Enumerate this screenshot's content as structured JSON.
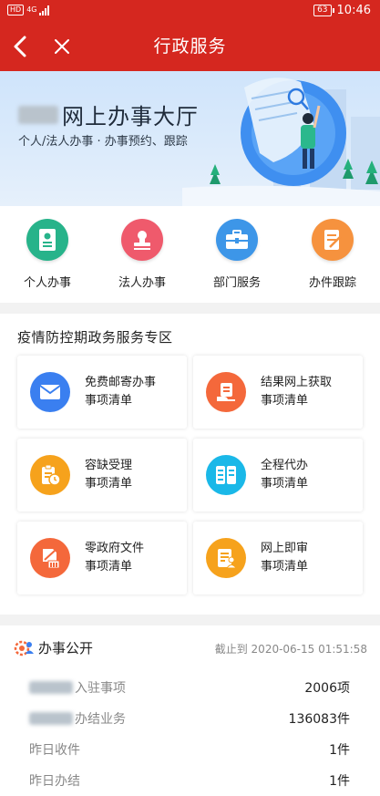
{
  "status_bar": {
    "hd": "HD",
    "network": "4G",
    "battery": "63",
    "time": "10:46"
  },
  "nav": {
    "title": "行政服务",
    "back_icon": "chevron-left-icon",
    "close_icon": "close-icon"
  },
  "banner": {
    "title": "网上办事大厅",
    "subtitle": "个人/法人办事 · 办事预约、跟踪"
  },
  "entries": [
    {
      "label": "个人办事",
      "icon": "person-card-icon",
      "color": "#27b38a"
    },
    {
      "label": "法人办事",
      "icon": "seal-icon",
      "color": "#ef5a6c"
    },
    {
      "label": "部门服务",
      "icon": "briefcase-icon",
      "color": "#3d96e8"
    },
    {
      "label": "办件跟踪",
      "icon": "document-track-icon",
      "color": "#f6923e"
    }
  ],
  "zone": {
    "title": "疫情防控期政务服务专区",
    "cards": [
      {
        "line1": "免费邮寄办事",
        "line2": "事项清单",
        "icon": "envelope-icon",
        "color": "#3a7ff0"
      },
      {
        "line1": "结果网上获取",
        "line2": "事项清单",
        "icon": "hand-document-icon",
        "color": "#f4683b"
      },
      {
        "line1": "容缺受理",
        "line2": "事项清单",
        "icon": "clipboard-clock-icon",
        "color": "#f6a21c"
      },
      {
        "line1": "全程代办",
        "line2": "事项清单",
        "icon": "list-icon",
        "color": "#1ab8e8"
      },
      {
        "line1": "零政府文件",
        "line2": "事项清单",
        "icon": "file-building-icon",
        "color": "#f4683b"
      },
      {
        "line1": "网上即审",
        "line2": "事项清单",
        "icon": "document-person-icon",
        "color": "#f6a21c"
      }
    ]
  },
  "public": {
    "title": "办事公开",
    "date_prefix": "截止到",
    "date": "2020-06-15 01:51:58",
    "stats": [
      {
        "name": "入驻事项",
        "value": "2006项"
      },
      {
        "name": "办结业务",
        "value": "136083件"
      },
      {
        "name": "昨日收件",
        "value": "1件"
      },
      {
        "name": "昨日办结",
        "value": "1件"
      }
    ]
  },
  "colors": {
    "brand_red": "#d5271f",
    "page_bg": "#f2f2f2"
  }
}
